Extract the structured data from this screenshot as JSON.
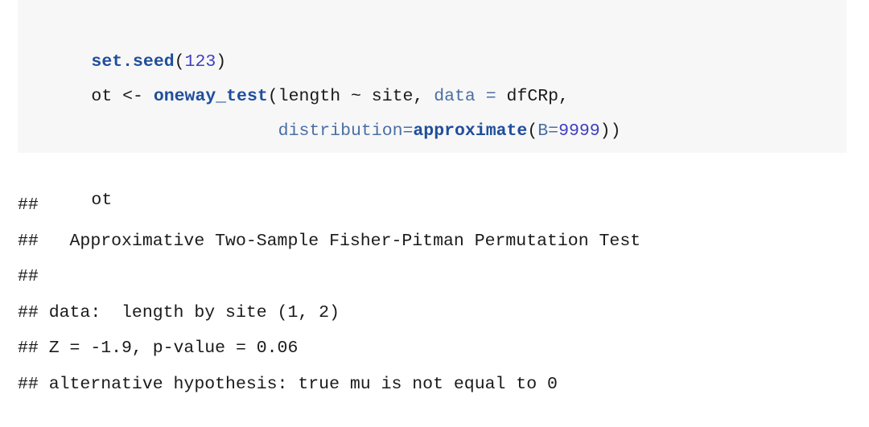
{
  "document": {
    "kind": "r-markdown-knitted-output",
    "code_block": {
      "background_color": "#f7f7f7",
      "language": "R",
      "lines": [
        {
          "id": "line-1",
          "tokens": [
            {
              "text": "set.seed",
              "type": "function"
            },
            {
              "text": "(",
              "type": "plain"
            },
            {
              "text": "123",
              "type": "number"
            },
            {
              "text": ")",
              "type": "plain"
            }
          ],
          "plain": "set.seed(123)"
        },
        {
          "id": "line-2",
          "tokens": [
            {
              "text": "ot <- ",
              "type": "plain"
            },
            {
              "text": "oneway_test",
              "type": "function"
            },
            {
              "text": "(length ~ site, ",
              "type": "plain"
            },
            {
              "text": "data",
              "type": "argument"
            },
            {
              "text": " ",
              "type": "plain"
            },
            {
              "text": "=",
              "type": "argument"
            },
            {
              "text": " dfCRp,",
              "type": "plain"
            }
          ],
          "plain": "ot <- oneway_test(length ~ site, data = dfCRp,"
        },
        {
          "id": "line-3",
          "tokens": [
            {
              "text": "                  ",
              "type": "plain"
            },
            {
              "text": "distribution",
              "type": "argument"
            },
            {
              "text": "=",
              "type": "argument"
            },
            {
              "text": "approximate",
              "type": "function"
            },
            {
              "text": "(",
              "type": "plain"
            },
            {
              "text": "B",
              "type": "argument"
            },
            {
              "text": "=",
              "type": "argument"
            },
            {
              "text": "9999",
              "type": "number"
            },
            {
              "text": "))",
              "type": "plain"
            }
          ],
          "plain": "                  distribution=approximate(B=9999))"
        },
        {
          "id": "line-4",
          "tokens": [
            {
              "text": "",
              "type": "plain"
            }
          ],
          "plain": ""
        },
        {
          "id": "line-5",
          "tokens": [
            {
              "text": "ot",
              "type": "plain"
            }
          ],
          "plain": "ot"
        }
      ]
    },
    "console_output": {
      "comment_prefix": "##",
      "lines": [
        {
          "id": "out-1",
          "text": "## "
        },
        {
          "id": "out-2",
          "text": "##   Approximative Two-Sample Fisher-Pitman Permutation Test"
        },
        {
          "id": "out-3",
          "text": "## "
        },
        {
          "id": "out-4",
          "text": "## data:  length by site (1, 2)"
        },
        {
          "id": "out-5",
          "text": "## Z = -1.9, p-value = 0.06"
        },
        {
          "id": "out-6",
          "text": "## alternative hypothesis: true mu is not equal to 0"
        }
      ],
      "test_title": "Approximative Two-Sample Fisher-Pitman Permutation Test",
      "data_description": "length by site (1, 2)",
      "statistic_label": "Z",
      "statistic_value": "-1.9",
      "p_value_label": "p-value",
      "p_value": "0.06",
      "alternative_hypothesis": "true mu is not equal to 0"
    },
    "colors": {
      "code_background": "#f7f7f7",
      "page_background": "#ffffff",
      "text": "#1a1a1a",
      "function_token": "#1f4e9c",
      "number_token": "#4040c0",
      "argument_token": "#4a6fa5"
    }
  }
}
